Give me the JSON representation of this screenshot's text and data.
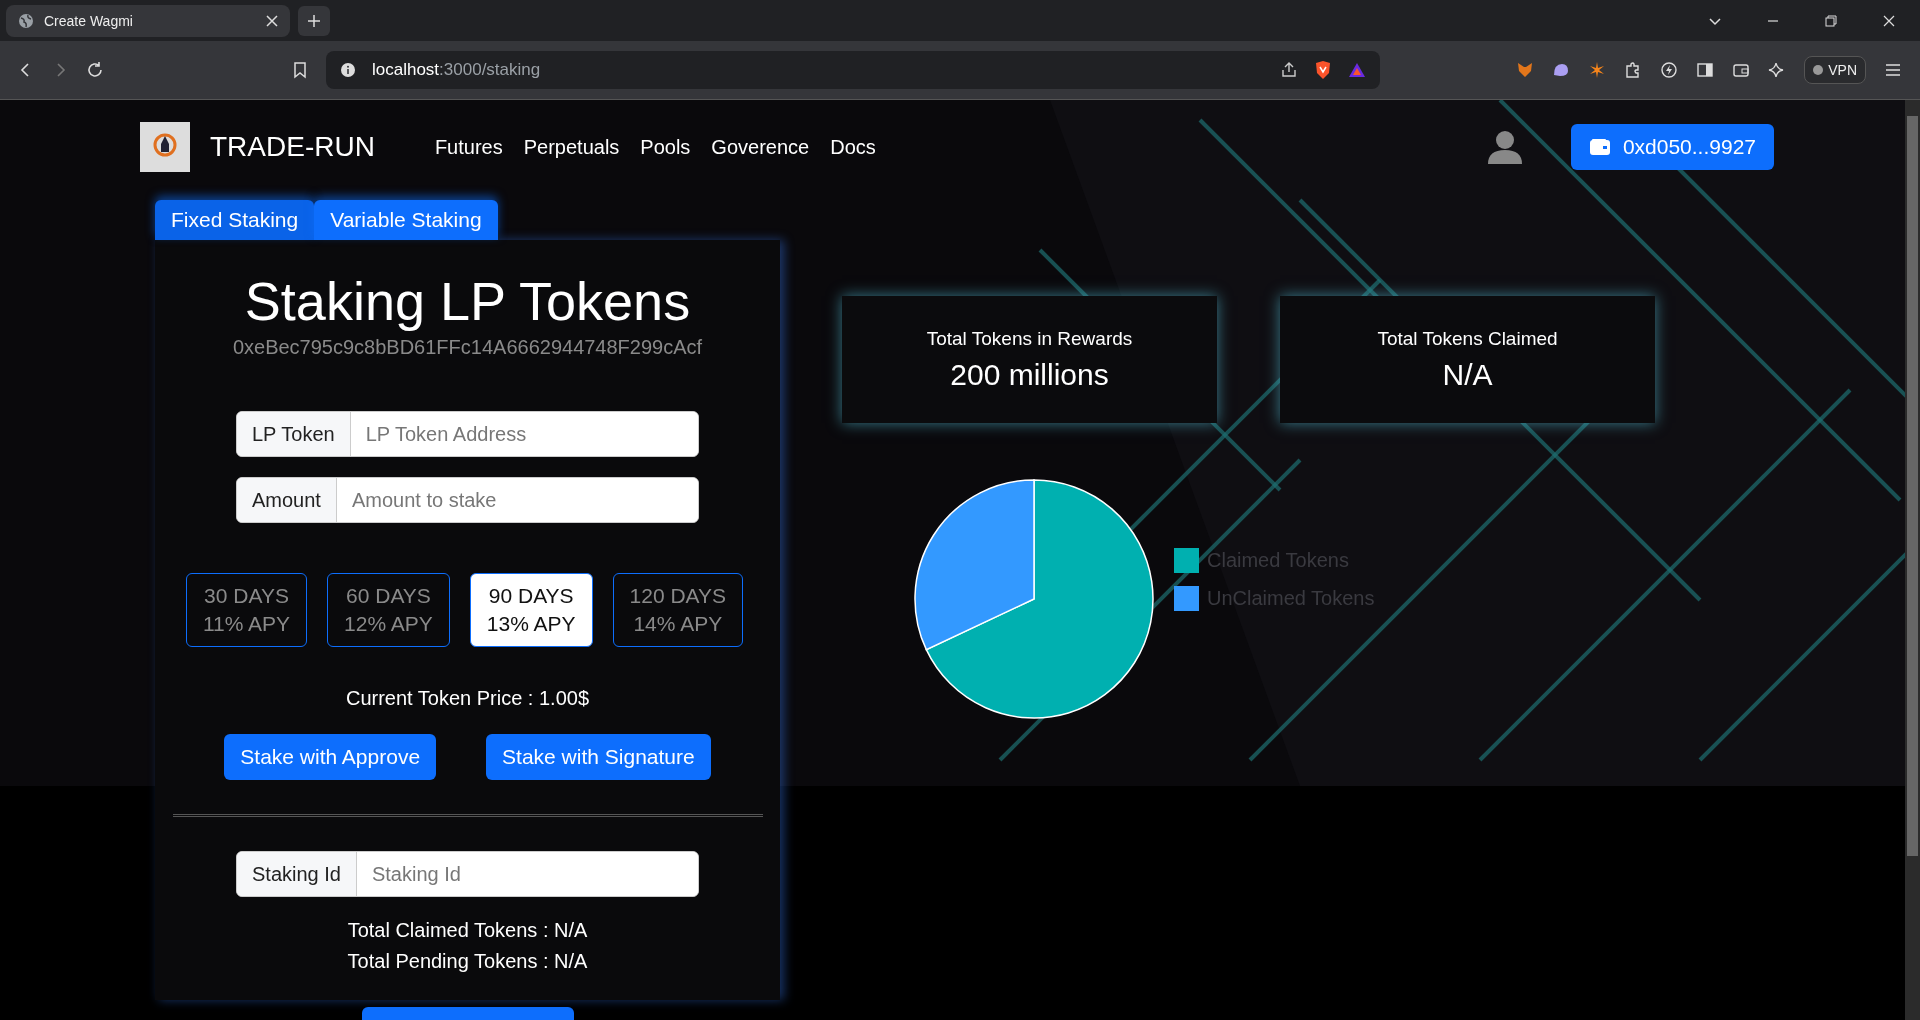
{
  "browser": {
    "tab_title": "Create Wagmi",
    "url_host": "localhost",
    "url_path": ":3000/staking",
    "vpn": "VPN"
  },
  "header": {
    "brand": "TRADE-RUN",
    "nav": [
      "Futures",
      "Perpetuals",
      "Pools",
      "Goverence",
      "Docs"
    ],
    "wallet": "0xd050...9927"
  },
  "staking_tabs": [
    {
      "label": "Fixed Staking",
      "selected": true
    },
    {
      "label": "Variable Staking",
      "selected": false
    }
  ],
  "panel": {
    "title": "Staking LP Tokens",
    "address": "0xeBec795c9c8bBD61FFc14A6662944748F299cAcf",
    "fields": [
      {
        "label": "LP Token",
        "placeholder": "LP Token Address"
      },
      {
        "label": "Amount",
        "placeholder": "Amount to stake"
      }
    ],
    "plans": [
      {
        "days": "30 DAYS",
        "apy": "11% APY",
        "selected": false
      },
      {
        "days": "60 DAYS",
        "apy": "12% APY",
        "selected": false
      },
      {
        "days": "90 DAYS",
        "apy": "13% APY",
        "selected": true
      },
      {
        "days": "120 DAYS",
        "apy": "14% APY",
        "selected": false
      }
    ],
    "price": "Current Token Price : 1.00$",
    "buttons": [
      "Stake with Approve",
      "Stake with Signature"
    ],
    "claim_field": {
      "label": "Staking Id",
      "placeholder": "Staking Id"
    },
    "totals": [
      "Total Claimed Tokens : N/A",
      "Total Pending Tokens : N/A"
    ]
  },
  "stats": [
    {
      "label": "Total Tokens in Rewards",
      "value": "200 millions"
    },
    {
      "label": "Total Tokens Claimed",
      "value": "N/A"
    }
  ],
  "chart_data": {
    "type": "pie",
    "categories": [
      "Claimed Tokens",
      "UnClaimed Tokens"
    ],
    "values": [
      68,
      32
    ],
    "colors": [
      "#00b0b0",
      "#3399ff"
    ],
    "legend": true
  }
}
